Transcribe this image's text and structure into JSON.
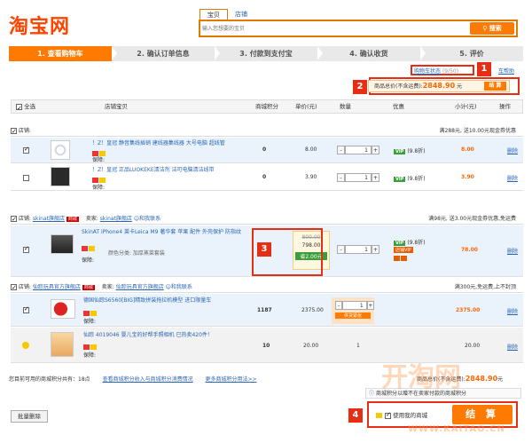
{
  "brand": {
    "logo_text": "淘宝网"
  },
  "search": {
    "tabs": [
      "宝贝",
      "店铺"
    ],
    "placeholder": "输入您想要的宝贝",
    "button_label": "搜索"
  },
  "steps": [
    "1. 查看购物车",
    "2. 确认订单信息",
    "3. 付款到支付宝",
    "4. 确认收货",
    "5. 评价"
  ],
  "annotations": [
    "1",
    "2",
    "3",
    "4"
  ],
  "cart_status": {
    "label": "购物车状态",
    "count": "(9/50)",
    "help": "车帮助"
  },
  "summary": {
    "label": "商品总价(不含运费):",
    "value": "2848.90",
    "unit": "元",
    "settle_label": "结 算"
  },
  "table_header": [
    "全选",
    "店铺宝贝",
    "商城积分",
    "单价(元)",
    "数量",
    "优惠",
    "小计(元)",
    "操作"
  ],
  "shops": [
    {
      "label": "店铺:",
      "name": "",
      "seller_label": "",
      "seller": "",
      "promo": "满288元, 送10.00元现金券优惠",
      "items": [
        {
          "title": "！Z！皇冠 静音集线插销 建线器集线器 大号电脑 超线管",
          "points": "0",
          "price": "8.00",
          "qty": "1",
          "discount": "(9.8折)",
          "subtotal": "8.00",
          "checked": true,
          "tag": "保障:"
        },
        {
          "title": "！Z！皇冠 正品LUOKEKE清洁剂 洁可电脑清洁线带",
          "points": "0",
          "price": "3.90",
          "qty": "1",
          "discount": "(9.8折)",
          "subtotal": "3.90",
          "checked": false,
          "tag": "保障:"
        }
      ]
    },
    {
      "label": "店铺:",
      "name": "skinat旗舰店",
      "mall_badge": "商城",
      "seller_label": "卖家:",
      "seller": "skinat旗舰店",
      "contact": "和我联系",
      "promo": "满98元, 送3.00元现金券优惠,免运费",
      "items": [
        {
          "title": "SkinAT iPhone4 莱卡Leica M9 著华套 苹果 配件 外壳保护 防指纹",
          "points": "0",
          "old_price": "800.00",
          "price": "798.00",
          "save": "省2.00元",
          "qty": "1",
          "discount": "(9.8折)",
          "vip_note": "店铺VIP",
          "subtotal": "78.00",
          "checked": true,
          "color_label": "颜色分类: 加厚蒸菜套装",
          "tag": "保障:"
        }
      ]
    },
    {
      "label": "店铺:",
      "name": "仙踪玩具官方旗舰店",
      "mall_badge": "商城",
      "seller_label": "卖家:",
      "seller": "仙踪玩具官方旗舰店",
      "contact": "和我联系",
      "promo": "满300元,免运费,上不封顶",
      "items": [
        {
          "title": "德国仙踪S6560[BIG]精致拼装拖拉机模型 进口限量车",
          "points": "1187",
          "price": "2375.00",
          "qty": "1",
          "stock_warn": "供货紧张",
          "subtotal": "2375.00",
          "checked": true,
          "tag": "保障:"
        },
        {
          "title": "仙踪 4019046 婴儿宝的好帮手照相机 已热卖420件！",
          "points": "10",
          "price": "20.00",
          "qty": "1",
          "subtotal": "20.00",
          "checked": false,
          "tag": "保障:"
        }
      ]
    }
  ],
  "bottom": {
    "points_info": "您目前可用的商城积分共有：18点",
    "points_link": "查看商城积分收入与商城积分消费情况",
    "points_rule": "更多商城积分用法>>",
    "total_label": "商品总价(不含运费):",
    "total_value": "2848.90",
    "total_unit": "元",
    "warn_text": "商城积分以赠不在卖家付款的商城积分",
    "use_points": "使用我的商城",
    "bulk_delete": "批量删除",
    "settle": "结 算",
    "delete_label": "删除"
  },
  "watermark": {
    "main": "开淘网",
    "url": "WWW.KAITAO.CN"
  }
}
